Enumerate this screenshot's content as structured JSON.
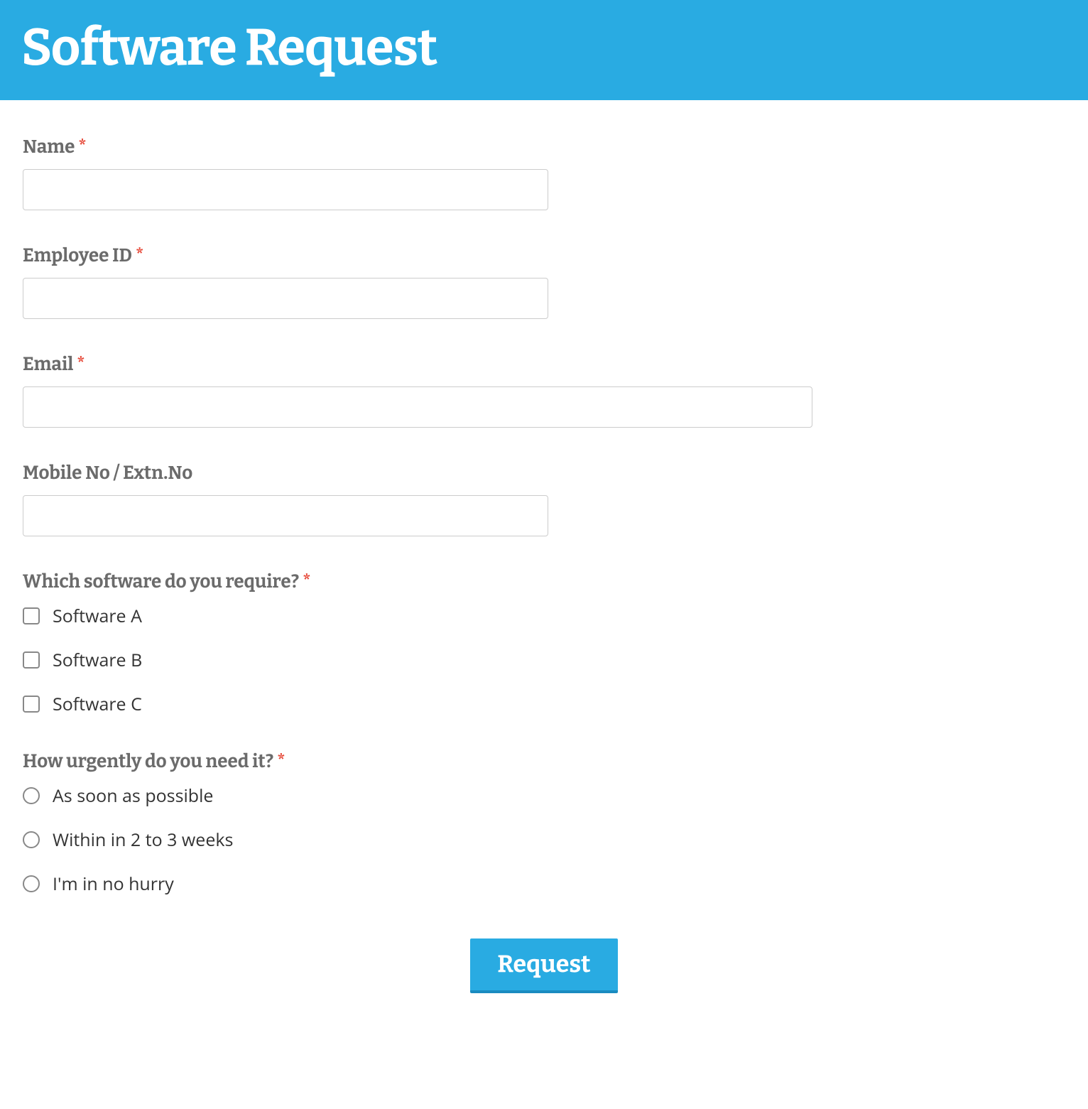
{
  "header": {
    "title": "Software Request"
  },
  "form": {
    "name": {
      "label": "Name",
      "required": "*",
      "value": ""
    },
    "employee_id": {
      "label": "Employee ID",
      "required": "*",
      "value": ""
    },
    "email": {
      "label": "Email",
      "required": "*",
      "value": ""
    },
    "mobile": {
      "label": "Mobile No / Extn.No",
      "value": ""
    },
    "software": {
      "label": "Which software do you require?",
      "required": "*",
      "options": [
        "Software A",
        "Software B",
        "Software C"
      ]
    },
    "urgency": {
      "label": "How urgently do you need it?",
      "required": "*",
      "options": [
        "As soon as possible",
        "Within in 2 to 3 weeks",
        "I'm in no hurry"
      ]
    },
    "submit_label": "Request"
  }
}
